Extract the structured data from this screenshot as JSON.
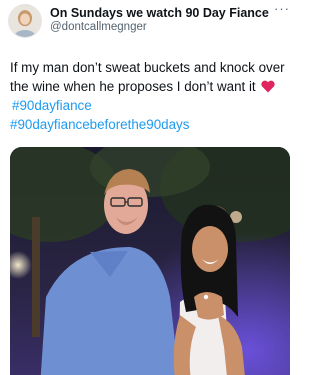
{
  "tweet": {
    "display_name": "On Sundays we watch 90 Day Fiance",
    "handle": "@dontcallmegnger",
    "more_label": "···",
    "text": "If my man don’t sweat buckets and knock over the wine when he proposes I don’t want it",
    "emoji": "red-heart",
    "hashtags": [
      "#90dayfiance",
      "#90dayfiancebeforethe90days"
    ]
  },
  "colors": {
    "link": "#1d9bf0",
    "secondary_text": "#536471",
    "primary_text": "#0f1419",
    "heart": "#e0245e"
  },
  "icons": {
    "more": "more-horizontal-icon",
    "emoji": "red-heart-icon",
    "avatar": "profile-avatar"
  }
}
